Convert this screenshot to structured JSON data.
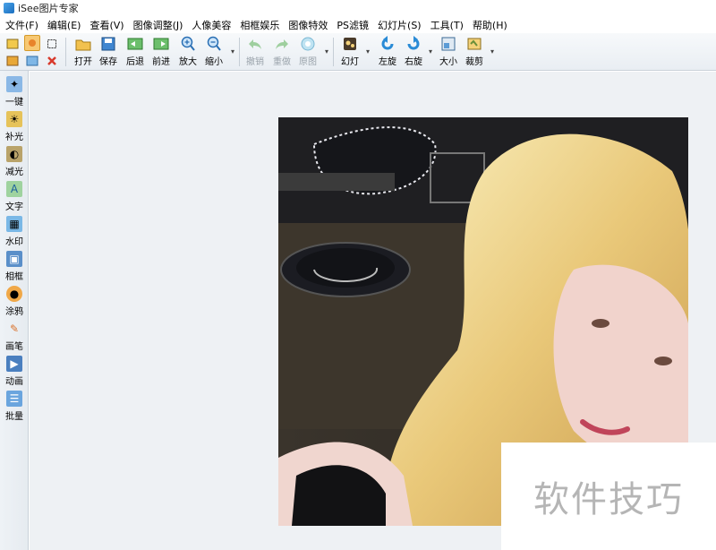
{
  "window": {
    "title": "iSee图片专家"
  },
  "menu": [
    "文件(F)",
    "编辑(E)",
    "查看(V)",
    "图像调整(J)",
    "人像美容",
    "相框娱乐",
    "图像特效",
    "PS滤镜",
    "幻灯片(S)",
    "工具(T)",
    "帮助(H)"
  ],
  "toolbar": {
    "open": "打开",
    "save": "保存",
    "back": "后退",
    "forward": "前进",
    "zoom_in": "放大",
    "zoom_out": "缩小",
    "undo": "撤销",
    "redo": "重做",
    "original": "原图",
    "slideshow": "幻灯",
    "rotate_left": "左旋",
    "rotate_right": "右旋",
    "resize": "大小",
    "crop": "裁剪"
  },
  "sidebar": {
    "items": [
      {
        "label": "一键"
      },
      {
        "label": "补光"
      },
      {
        "label": "减光"
      },
      {
        "label": "文字"
      },
      {
        "label": "水印"
      },
      {
        "label": "相框"
      },
      {
        "label": "涂鸦"
      },
      {
        "label": "画笔"
      },
      {
        "label": "动画"
      },
      {
        "label": "批量"
      }
    ]
  },
  "watermark": {
    "text": "软件技巧"
  },
  "colors": {
    "accent_blue": "#1e7ad6",
    "toolbar_bg": "#eef2f6",
    "canvas_bg": "#eef1f4"
  }
}
